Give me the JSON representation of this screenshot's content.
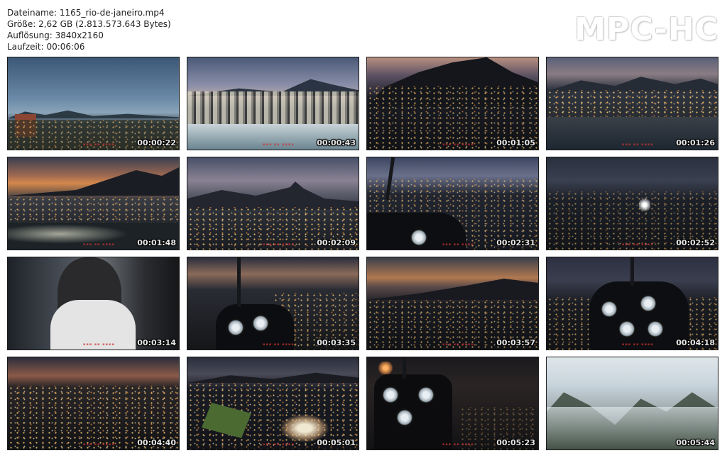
{
  "info": {
    "filename": "Dateiname: 1165_rio-de-janeiro.mp4",
    "size": "Größe: 2,62 GB (2.813.573.643 Bytes)",
    "resolution": "Auflösung: 3840x2160",
    "duration": "Laufzeit: 00:06:06"
  },
  "logo": "MPC-HC",
  "thumbnails": [
    {
      "time": "00:00:22",
      "scene": "dusk-coast-city"
    },
    {
      "time": "00:00:43",
      "scene": "beachfront-towers"
    },
    {
      "time": "00:01:05",
      "scene": "night-mountain-city"
    },
    {
      "time": "00:01:26",
      "scene": "beach-dusk-lights"
    },
    {
      "time": "00:01:48",
      "scene": "sunset-beach-lights"
    },
    {
      "time": "00:02:09",
      "scene": "sugarloaf-dusk"
    },
    {
      "time": "00:02:31",
      "scene": "cockpit-bay"
    },
    {
      "time": "00:02:52",
      "scene": "christ-redeemer-night"
    },
    {
      "time": "00:03:14",
      "scene": "pilot-portrait"
    },
    {
      "time": "00:03:35",
      "scene": "cockpit-coast-night"
    },
    {
      "time": "00:03:57",
      "scene": "sunset-city-night"
    },
    {
      "time": "00:04:18",
      "scene": "cockpit-city-night"
    },
    {
      "time": "00:04:40",
      "scene": "night-city-glow"
    },
    {
      "time": "00:05:01",
      "scene": "stadium-night"
    },
    {
      "time": "00:05:23",
      "scene": "cockpit-dark"
    },
    {
      "time": "00:05:44",
      "scene": "misty-mountains"
    }
  ]
}
